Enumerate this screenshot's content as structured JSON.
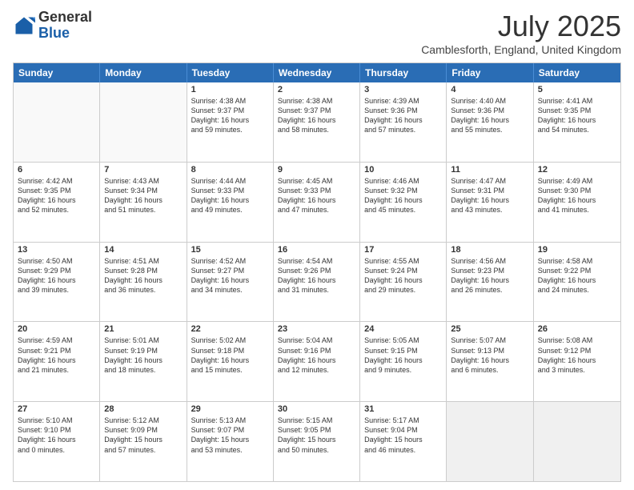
{
  "logo": {
    "general": "General",
    "blue": "Blue"
  },
  "title": "July 2025",
  "location": "Camblesforth, England, United Kingdom",
  "days_of_week": [
    "Sunday",
    "Monday",
    "Tuesday",
    "Wednesday",
    "Thursday",
    "Friday",
    "Saturday"
  ],
  "weeks": [
    [
      {
        "day": "",
        "empty": true
      },
      {
        "day": "",
        "empty": true
      },
      {
        "day": "1",
        "line1": "Sunrise: 4:38 AM",
        "line2": "Sunset: 9:37 PM",
        "line3": "Daylight: 16 hours",
        "line4": "and 59 minutes."
      },
      {
        "day": "2",
        "line1": "Sunrise: 4:38 AM",
        "line2": "Sunset: 9:37 PM",
        "line3": "Daylight: 16 hours",
        "line4": "and 58 minutes."
      },
      {
        "day": "3",
        "line1": "Sunrise: 4:39 AM",
        "line2": "Sunset: 9:36 PM",
        "line3": "Daylight: 16 hours",
        "line4": "and 57 minutes."
      },
      {
        "day": "4",
        "line1": "Sunrise: 4:40 AM",
        "line2": "Sunset: 9:36 PM",
        "line3": "Daylight: 16 hours",
        "line4": "and 55 minutes."
      },
      {
        "day": "5",
        "line1": "Sunrise: 4:41 AM",
        "line2": "Sunset: 9:35 PM",
        "line3": "Daylight: 16 hours",
        "line4": "and 54 minutes."
      }
    ],
    [
      {
        "day": "6",
        "line1": "Sunrise: 4:42 AM",
        "line2": "Sunset: 9:35 PM",
        "line3": "Daylight: 16 hours",
        "line4": "and 52 minutes."
      },
      {
        "day": "7",
        "line1": "Sunrise: 4:43 AM",
        "line2": "Sunset: 9:34 PM",
        "line3": "Daylight: 16 hours",
        "line4": "and 51 minutes."
      },
      {
        "day": "8",
        "line1": "Sunrise: 4:44 AM",
        "line2": "Sunset: 9:33 PM",
        "line3": "Daylight: 16 hours",
        "line4": "and 49 minutes."
      },
      {
        "day": "9",
        "line1": "Sunrise: 4:45 AM",
        "line2": "Sunset: 9:33 PM",
        "line3": "Daylight: 16 hours",
        "line4": "and 47 minutes."
      },
      {
        "day": "10",
        "line1": "Sunrise: 4:46 AM",
        "line2": "Sunset: 9:32 PM",
        "line3": "Daylight: 16 hours",
        "line4": "and 45 minutes."
      },
      {
        "day": "11",
        "line1": "Sunrise: 4:47 AM",
        "line2": "Sunset: 9:31 PM",
        "line3": "Daylight: 16 hours",
        "line4": "and 43 minutes."
      },
      {
        "day": "12",
        "line1": "Sunrise: 4:49 AM",
        "line2": "Sunset: 9:30 PM",
        "line3": "Daylight: 16 hours",
        "line4": "and 41 minutes."
      }
    ],
    [
      {
        "day": "13",
        "line1": "Sunrise: 4:50 AM",
        "line2": "Sunset: 9:29 PM",
        "line3": "Daylight: 16 hours",
        "line4": "and 39 minutes."
      },
      {
        "day": "14",
        "line1": "Sunrise: 4:51 AM",
        "line2": "Sunset: 9:28 PM",
        "line3": "Daylight: 16 hours",
        "line4": "and 36 minutes."
      },
      {
        "day": "15",
        "line1": "Sunrise: 4:52 AM",
        "line2": "Sunset: 9:27 PM",
        "line3": "Daylight: 16 hours",
        "line4": "and 34 minutes."
      },
      {
        "day": "16",
        "line1": "Sunrise: 4:54 AM",
        "line2": "Sunset: 9:26 PM",
        "line3": "Daylight: 16 hours",
        "line4": "and 31 minutes."
      },
      {
        "day": "17",
        "line1": "Sunrise: 4:55 AM",
        "line2": "Sunset: 9:24 PM",
        "line3": "Daylight: 16 hours",
        "line4": "and 29 minutes."
      },
      {
        "day": "18",
        "line1": "Sunrise: 4:56 AM",
        "line2": "Sunset: 9:23 PM",
        "line3": "Daylight: 16 hours",
        "line4": "and 26 minutes."
      },
      {
        "day": "19",
        "line1": "Sunrise: 4:58 AM",
        "line2": "Sunset: 9:22 PM",
        "line3": "Daylight: 16 hours",
        "line4": "and 24 minutes."
      }
    ],
    [
      {
        "day": "20",
        "line1": "Sunrise: 4:59 AM",
        "line2": "Sunset: 9:21 PM",
        "line3": "Daylight: 16 hours",
        "line4": "and 21 minutes."
      },
      {
        "day": "21",
        "line1": "Sunrise: 5:01 AM",
        "line2": "Sunset: 9:19 PM",
        "line3": "Daylight: 16 hours",
        "line4": "and 18 minutes."
      },
      {
        "day": "22",
        "line1": "Sunrise: 5:02 AM",
        "line2": "Sunset: 9:18 PM",
        "line3": "Daylight: 16 hours",
        "line4": "and 15 minutes."
      },
      {
        "day": "23",
        "line1": "Sunrise: 5:04 AM",
        "line2": "Sunset: 9:16 PM",
        "line3": "Daylight: 16 hours",
        "line4": "and 12 minutes."
      },
      {
        "day": "24",
        "line1": "Sunrise: 5:05 AM",
        "line2": "Sunset: 9:15 PM",
        "line3": "Daylight: 16 hours",
        "line4": "and 9 minutes."
      },
      {
        "day": "25",
        "line1": "Sunrise: 5:07 AM",
        "line2": "Sunset: 9:13 PM",
        "line3": "Daylight: 16 hours",
        "line4": "and 6 minutes."
      },
      {
        "day": "26",
        "line1": "Sunrise: 5:08 AM",
        "line2": "Sunset: 9:12 PM",
        "line3": "Daylight: 16 hours",
        "line4": "and 3 minutes."
      }
    ],
    [
      {
        "day": "27",
        "line1": "Sunrise: 5:10 AM",
        "line2": "Sunset: 9:10 PM",
        "line3": "Daylight: 16 hours",
        "line4": "and 0 minutes."
      },
      {
        "day": "28",
        "line1": "Sunrise: 5:12 AM",
        "line2": "Sunset: 9:09 PM",
        "line3": "Daylight: 15 hours",
        "line4": "and 57 minutes."
      },
      {
        "day": "29",
        "line1": "Sunrise: 5:13 AM",
        "line2": "Sunset: 9:07 PM",
        "line3": "Daylight: 15 hours",
        "line4": "and 53 minutes."
      },
      {
        "day": "30",
        "line1": "Sunrise: 5:15 AM",
        "line2": "Sunset: 9:05 PM",
        "line3": "Daylight: 15 hours",
        "line4": "and 50 minutes."
      },
      {
        "day": "31",
        "line1": "Sunrise: 5:17 AM",
        "line2": "Sunset: 9:04 PM",
        "line3": "Daylight: 15 hours",
        "line4": "and 46 minutes."
      },
      {
        "day": "",
        "empty": true
      },
      {
        "day": "",
        "empty": true
      }
    ]
  ]
}
